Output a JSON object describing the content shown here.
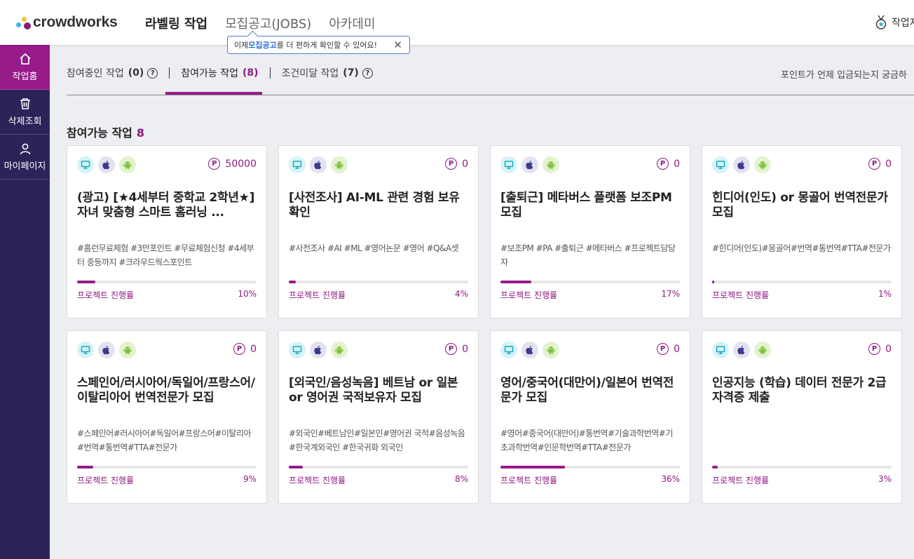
{
  "header": {
    "logo_text": "crowdworks",
    "nav": [
      {
        "label": "라벨링 작업"
      },
      {
        "label": "모집공고(JOBS)"
      },
      {
        "label": "아카데미"
      }
    ],
    "tooltip": {
      "prefix": "이제 ",
      "highlight": "모집공고",
      "suffix": "를 더 편하게 확인할 수 있어요!",
      "close": "✕"
    },
    "right_label": "작업자"
  },
  "sidebar": {
    "items": [
      {
        "label": "작업홈",
        "icon": "home-icon"
      },
      {
        "label": "삭제조회",
        "icon": "trash-icon"
      },
      {
        "label": "마이페이지",
        "icon": "user-icon"
      }
    ]
  },
  "tabs": [
    {
      "label": "참여중인 작업",
      "count": "(0)",
      "help": "?"
    },
    {
      "label": "참여가능 작업",
      "count": "(8)"
    },
    {
      "label": "조건미달 작업",
      "count": "(7)",
      "help": "?"
    }
  ],
  "help_link": "포인트가 언제 입금되는지 궁금하",
  "section": {
    "title": "참여가능 작업",
    "count": "8"
  },
  "progress_label": "프로젝트 진행률",
  "point_symbol": "P",
  "colors": {
    "accent": "#971b89",
    "sidebar": "#2a2459"
  },
  "cards": [
    {
      "points": "50000",
      "title": "(광고) [★4세부터 중학교 2학년★] 자녀 맞춤형 스마트 홈러닝 ...",
      "tags": "#홈런무료체험 #3만포인트 #무료체험신청 #4세부터 중등까지 #크라우드웍스포인트",
      "progress": 10,
      "progress_text": "10%"
    },
    {
      "points": "0",
      "title": "[사전조사] AI-ML 관련 경험 보유 확인",
      "tags": "#사전조사 #AI #ML #영어논문 #영어 #Q&A셋",
      "progress": 4,
      "progress_text": "4%"
    },
    {
      "points": "0",
      "title": "[출퇴근] 메타버스 플랫폼 보조PM 모집",
      "tags": "#보조PM #PA #출퇴근 #메타버스 #프로젝트담당자",
      "progress": 17,
      "progress_text": "17%"
    },
    {
      "points": "0",
      "title": "힌디어(인도) or 몽골어 번역전문가 모집",
      "tags": "#힌디어(인도)#몽골어#번역#통번역#TTA#전문가",
      "progress": 1,
      "progress_text": "1%"
    },
    {
      "points": "0",
      "title": "스페인어/러시아어/독일어/프랑스어/이탈리아어 번역전문가 모집",
      "tags": "#스페인어#러시아어#독일어#프랑스어#이탈리아#번역#통번역#TTA#전문가",
      "progress": 9,
      "progress_text": "9%"
    },
    {
      "points": "0",
      "title": "[외국인/음성녹음] 베트남 or 일본 or 영어권 국적보유자 모집",
      "tags": "#외국인#베트남인#일본인#영어권 국적#음성녹음#한국계외국인 #한국귀화 외국인",
      "progress": 8,
      "progress_text": "8%"
    },
    {
      "points": "0",
      "title": "영어/중국어(대만어)/일본어 번역전문가 모집",
      "tags": "#영어#중국어(대만어)#통번역#기술과학번역#기초과학번역#인문학번역#TTA#전문가",
      "progress": 36,
      "progress_text": "36%"
    },
    {
      "points": "0",
      "title": "인공지능 (학습) 데이터 전문가 2급 자격증 제출",
      "tags": "",
      "progress": 3,
      "progress_text": "3%"
    }
  ]
}
